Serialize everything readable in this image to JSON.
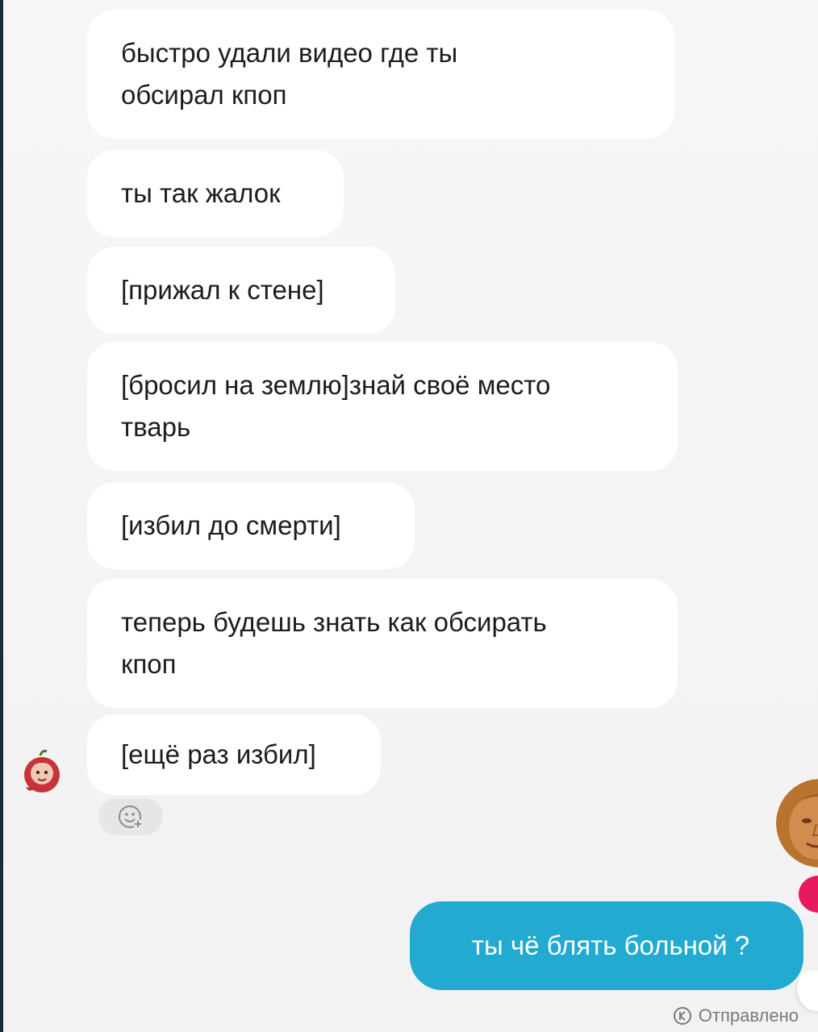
{
  "messages": [
    {
      "text": "быстро удали видео где ты\nобсирал кпоп"
    },
    {
      "text": "ты так жалок"
    },
    {
      "text": "[прижал к стене]"
    },
    {
      "text": "[бросил на землю]знай своё место\nтварь"
    },
    {
      "text": "[избил до смерти]"
    },
    {
      "text": "теперь будешь знать как обсирать\nкпоп"
    },
    {
      "text": "[ещё раз избил]"
    }
  ],
  "sent": {
    "text": "ты чё блять больной ?",
    "status": "Отправлено"
  },
  "colors": {
    "sent_bubble": "#22aad1",
    "received_bubble": "#ffffff",
    "background": "#f4f4f5",
    "badge": "#e7195f"
  },
  "icons": {
    "reaction": "emoji-add-icon",
    "status": "sent-check-icon"
  }
}
